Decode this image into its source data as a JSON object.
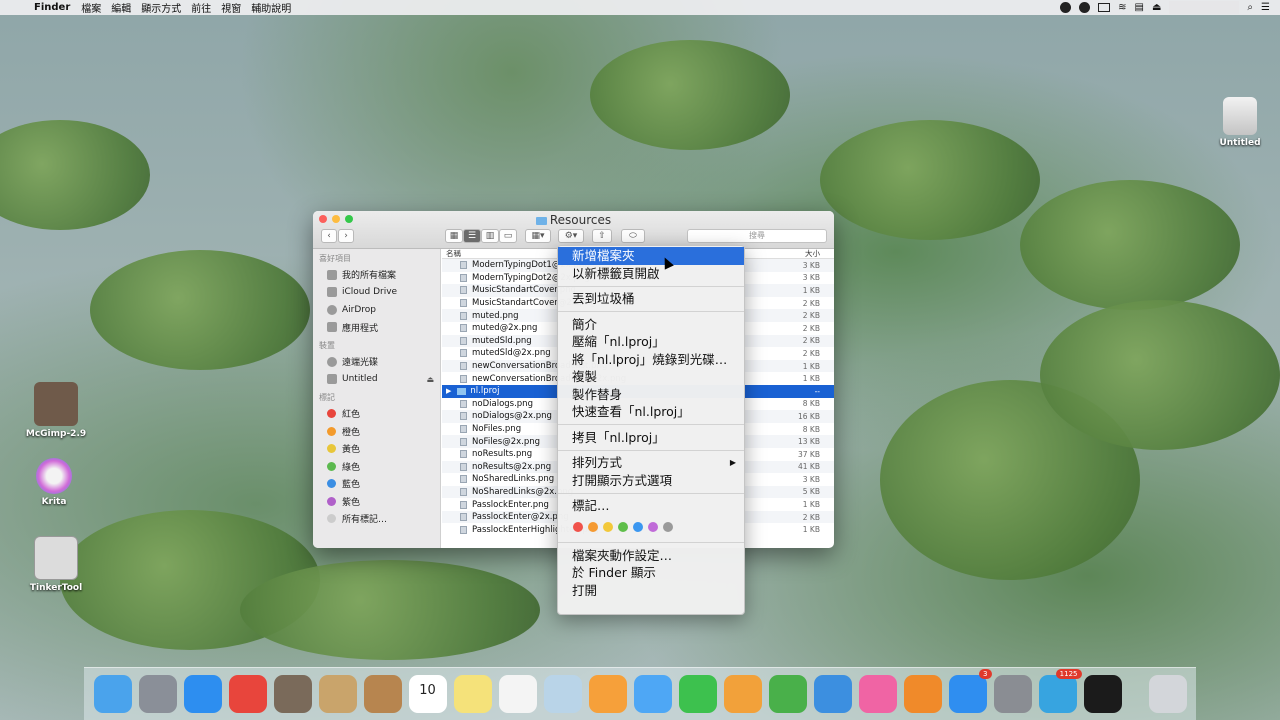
{
  "menubar": {
    "apple": "",
    "app": "Finder",
    "items": [
      "檔案",
      "編輯",
      "顯示方式",
      "前往",
      "視窗",
      "輔助說明"
    ]
  },
  "desktop": {
    "icons": [
      {
        "label": "Untitled",
        "icon": "external-drive-icon"
      },
      {
        "label": "McGimp-2.9",
        "icon": "gimp-icon"
      },
      {
        "label": "Krita",
        "icon": "krita-icon"
      },
      {
        "label": "TinkerTool",
        "icon": "tinkertool-icon"
      }
    ]
  },
  "finder": {
    "title": "Resources",
    "search_placeholder": "搜尋",
    "sidebar": {
      "favorites_header": "喜好項目",
      "favorites": [
        "我的所有檔案",
        "iCloud Drive",
        "AirDrop",
        "應用程式"
      ],
      "devices_header": "裝置",
      "devices": [
        "遠端光碟",
        "Untitled"
      ],
      "tags_header": "標記",
      "tags": [
        {
          "label": "紅色",
          "color": "#e8453c"
        },
        {
          "label": "橙色",
          "color": "#f39a2b"
        },
        {
          "label": "黃色",
          "color": "#e8c63a"
        },
        {
          "label": "綠色",
          "color": "#5cb94f"
        },
        {
          "label": "藍色",
          "color": "#3b8ee3"
        },
        {
          "label": "紫色",
          "color": "#b060c9"
        },
        {
          "label": "所有標記…",
          "color": "#cccccc"
        }
      ]
    },
    "columns": {
      "name": "名稱",
      "size": "大小"
    },
    "files": [
      {
        "name": "ModernTypingDot1@2x.png",
        "size": "3 KB"
      },
      {
        "name": "ModernTypingDot2@2x.png",
        "size": "3 KB"
      },
      {
        "name": "MusicStandartCover.png",
        "size": "1 KB"
      },
      {
        "name": "MusicStandartCover@2x.png",
        "size": "2 KB"
      },
      {
        "name": "muted.png",
        "size": "2 KB"
      },
      {
        "name": "muted@2x.png",
        "size": "2 KB"
      },
      {
        "name": "mutedSld.png",
        "size": "2 KB"
      },
      {
        "name": "mutedSld@2x.png",
        "size": "2 KB"
      },
      {
        "name": "newConversationBroadcast.png",
        "size": "1 KB"
      },
      {
        "name": "newConversationBroadcast@2x.png",
        "size": "1 KB"
      },
      {
        "name": "nl.lproj",
        "size": "--",
        "selected": true
      },
      {
        "name": "noDialogs.png",
        "size": "8 KB"
      },
      {
        "name": "noDialogs@2x.png",
        "size": "16 KB"
      },
      {
        "name": "NoFiles.png",
        "size": "8 KB"
      },
      {
        "name": "NoFiles@2x.png",
        "size": "13 KB"
      },
      {
        "name": "noResults.png",
        "size": "37 KB"
      },
      {
        "name": "noResults@2x.png",
        "size": "41 KB"
      },
      {
        "name": "NoSharedLinks.png",
        "size": "3 KB"
      },
      {
        "name": "NoSharedLinks@2x.png",
        "size": "5 KB"
      },
      {
        "name": "PasslockEnter.png",
        "size": "1 KB"
      },
      {
        "name": "PasslockEnter@2x.png",
        "size": "2 KB"
      },
      {
        "name": "PasslockEnterHighlighted.png",
        "size": "1 KB"
      }
    ]
  },
  "context_menu": {
    "groups": [
      [
        "新增檔案夾",
        "以新標籤頁開啟"
      ],
      [
        "丟到垃圾桶"
      ],
      [
        "簡介",
        "壓縮「nl.lproj」",
        "將「nl.lproj」燒錄到光碟…",
        "複製",
        "製作替身",
        "快速查看「nl.lproj」"
      ],
      [
        "拷貝「nl.lproj」"
      ],
      [
        "排列方式",
        "打開顯示方式選項"
      ],
      [
        "標記…"
      ],
      [
        "檔案夾動作設定…",
        "於 Finder 顯示",
        "打開"
      ]
    ],
    "highlighted": "新增檔案夾",
    "submenu_item": "排列方式",
    "tag_colors": [
      "#f0524a",
      "#f59a32",
      "#f2c83a",
      "#5fbe4a",
      "#3b97f0",
      "#c06bd8",
      "#9a9a9a"
    ]
  },
  "dock": {
    "apps": [
      {
        "icon": "finder-icon",
        "color": "#4aa3ec"
      },
      {
        "icon": "launchpad-icon",
        "color": "#8a8f98"
      },
      {
        "icon": "safari-icon",
        "color": "#2d8ef0"
      },
      {
        "icon": "chrome-icon",
        "color": "#e8453c"
      },
      {
        "icon": "gimp-icon",
        "color": "#7a6a5a"
      },
      {
        "icon": "mail-icon",
        "color": "#c9a46b"
      },
      {
        "icon": "contacts-icon",
        "color": "#b7854f"
      },
      {
        "icon": "calendar-icon",
        "color": "#ffffff",
        "text": "10"
      },
      {
        "icon": "notes-icon",
        "color": "#f5e27a"
      },
      {
        "icon": "reminders-icon",
        "color": "#f4f4f4"
      },
      {
        "icon": "preview-icon",
        "color": "#b9d4e8"
      },
      {
        "icon": "photos-icon",
        "color": "#f6a03a"
      },
      {
        "icon": "messages-icon",
        "color": "#4ea7f5"
      },
      {
        "icon": "facetime-icon",
        "color": "#3dc14e"
      },
      {
        "icon": "pages-icon",
        "color": "#f2a13a"
      },
      {
        "icon": "numbers-icon",
        "color": "#49b04a"
      },
      {
        "icon": "keynote-icon",
        "color": "#3c8fe0"
      },
      {
        "icon": "itunes-icon",
        "color": "#f064a4"
      },
      {
        "icon": "ibooks-icon",
        "color": "#f08a2a"
      },
      {
        "icon": "app-store-icon",
        "color": "#2f8ef0",
        "badge": "3"
      },
      {
        "icon": "system-preferences-icon",
        "color": "#8a8d93"
      },
      {
        "icon": "telegram-icon",
        "color": "#37a4e0",
        "badge": "1125"
      },
      {
        "icon": "terminal-icon",
        "color": "#1b1b1b"
      },
      {
        "icon": "trash-icon",
        "color": "#d3d6da"
      }
    ]
  }
}
